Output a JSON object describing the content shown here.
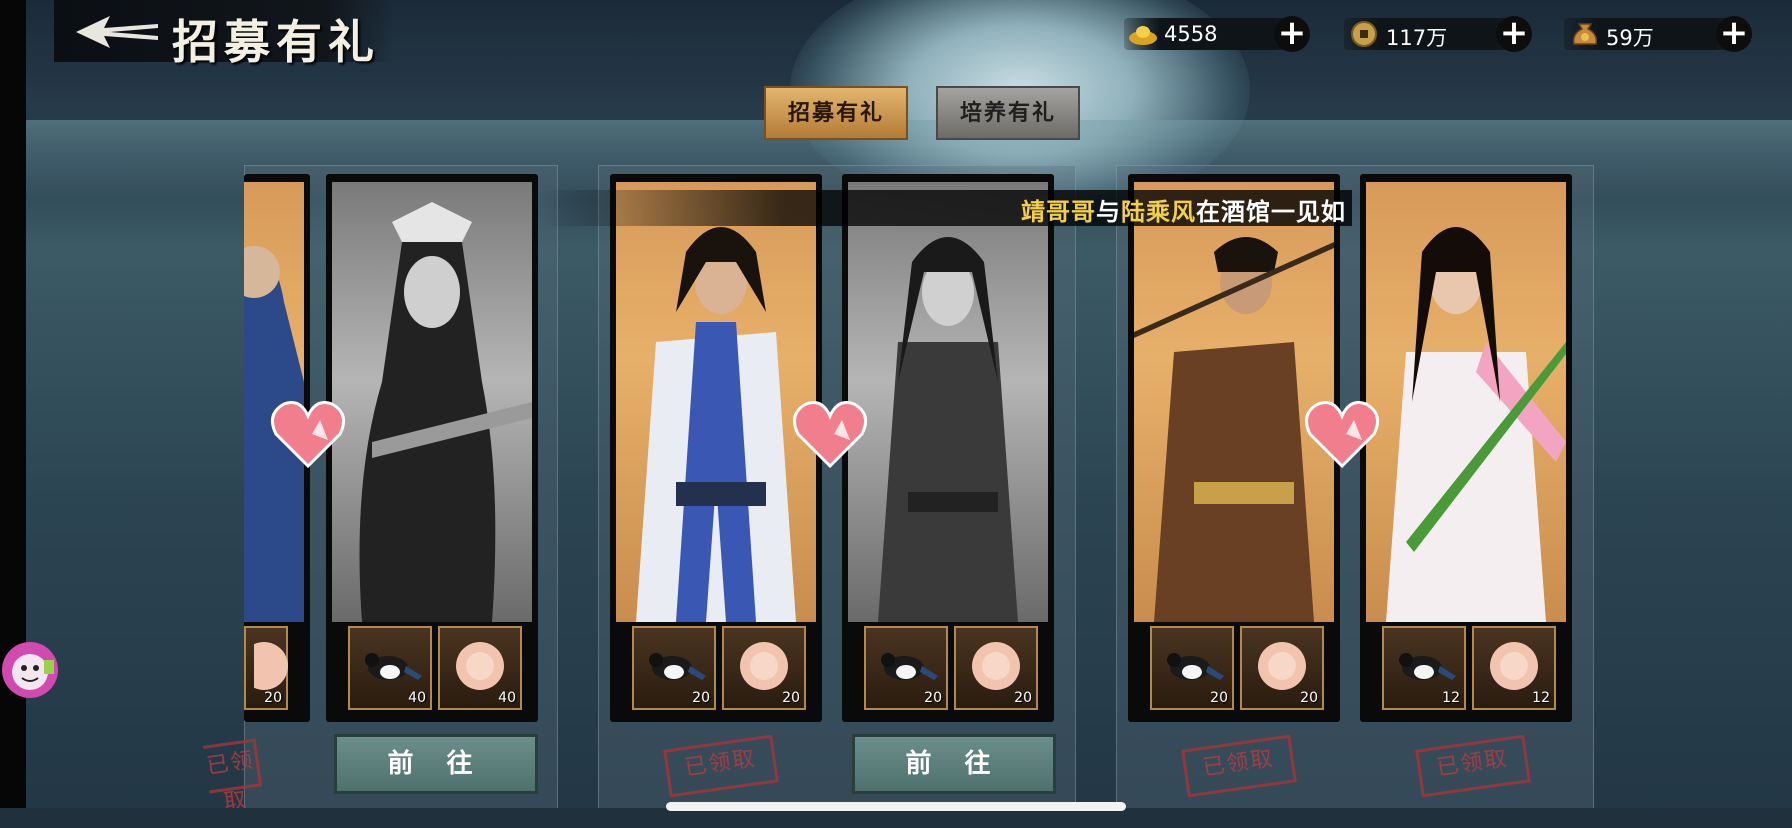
{
  "header": {
    "title": "招募有礼"
  },
  "currencies": [
    {
      "icon": "gold-ingot-icon",
      "value": "4558"
    },
    {
      "icon": "copper-coin-icon",
      "value": "117万"
    },
    {
      "icon": "money-bag-icon",
      "value": "59万"
    }
  ],
  "tabs": [
    {
      "label": "招募有礼",
      "active": true
    },
    {
      "label": "培养有礼",
      "active": false
    }
  ],
  "banner": {
    "part1": "靖哥哥",
    "mid": "与",
    "part2": "陆乘风",
    "suffix": "在酒馆一见如"
  },
  "pairs": [
    {
      "action": "已领取",
      "cards": [
        {
          "tone": "color",
          "items": [
            null,
            "20"
          ]
        },
        {
          "tone": "gray",
          "items": [
            "40",
            "40"
          ]
        }
      ]
    },
    {
      "action": "前 往",
      "cards": [
        {
          "tone": "color",
          "items": [
            "20",
            "20"
          ]
        },
        {
          "tone": "gray",
          "items": [
            "20",
            "20"
          ]
        }
      ]
    },
    {
      "action": "已领取",
      "cards": [
        {
          "tone": "color",
          "items": [
            "20",
            "20"
          ]
        },
        {
          "tone": "color",
          "items": [
            "12",
            "12"
          ]
        }
      ]
    }
  ],
  "colors": {
    "accent_gold": "#f2d04a",
    "stamp_red": "#b13c40",
    "button_teal": "#5f827e"
  }
}
